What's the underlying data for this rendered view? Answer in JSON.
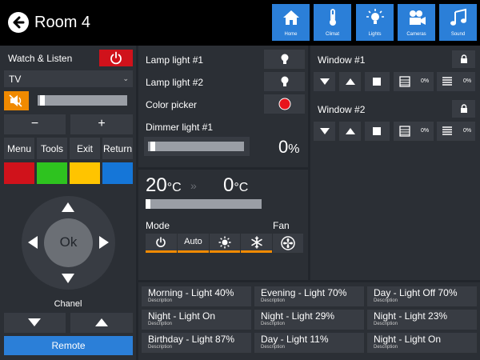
{
  "header": {
    "title": "Room 4",
    "nav": [
      {
        "label": "Home",
        "icon": "home-icon"
      },
      {
        "label": "Climat",
        "icon": "thermometer-icon"
      },
      {
        "label": "Lights",
        "icon": "lightbulb-icon"
      },
      {
        "label": "Cameras",
        "icon": "camera-icon"
      },
      {
        "label": "Sound",
        "icon": "music-note-icon"
      }
    ]
  },
  "media": {
    "title": "Watch & Listen",
    "source": "TV",
    "volume": 0.03,
    "minus": "−",
    "plus": "+",
    "buttons": [
      "Menu",
      "Tools",
      "Exit",
      "Return"
    ],
    "color_keys": [
      "#d0121b",
      "#2ec31f",
      "#ffc400",
      "#1576d8"
    ],
    "ok": "Ok",
    "channel_label": "Chanel",
    "remote_label": "Remote"
  },
  "lights": {
    "items": [
      "Lamp light #1",
      "Lamp light #2",
      "Color picker"
    ],
    "picker_color": "#e8131b",
    "dimmer_label": "Dimmer light #1",
    "dimmer_value": "0",
    "dimmer_unit": "%",
    "dimmer_level": 0.03
  },
  "climate": {
    "current_temp": "20",
    "target_temp": "0",
    "unit": "°C",
    "mode_label": "Mode",
    "fan_label": "Fan",
    "mode_auto": "Auto"
  },
  "windows": [
    {
      "title": "Window #1",
      "tilt": "0%",
      "shade": "0%"
    },
    {
      "title": "Window #2",
      "tilt": "0%",
      "shade": "0%"
    }
  ],
  "scenes": [
    {
      "title": "Morning - Light 40%",
      "desc": "Description"
    },
    {
      "title": "Evening - Light 70%",
      "desc": "Description"
    },
    {
      "title": "Day - Light Off 70%",
      "desc": "Description"
    },
    {
      "title": "Night - Light On",
      "desc": "Description"
    },
    {
      "title": "Night - Light 29%",
      "desc": "Description"
    },
    {
      "title": "Night - Light 23%",
      "desc": "Description"
    },
    {
      "title": "Birthday - Light 87%",
      "desc": "Description"
    },
    {
      "title": "Day - Light 11%",
      "desc": "Description"
    },
    {
      "title": "Night - Light On",
      "desc": "Description"
    }
  ],
  "colors": {
    "accent": "#2b7fd8",
    "power": "#d0121b",
    "mode": "#f08a00"
  }
}
